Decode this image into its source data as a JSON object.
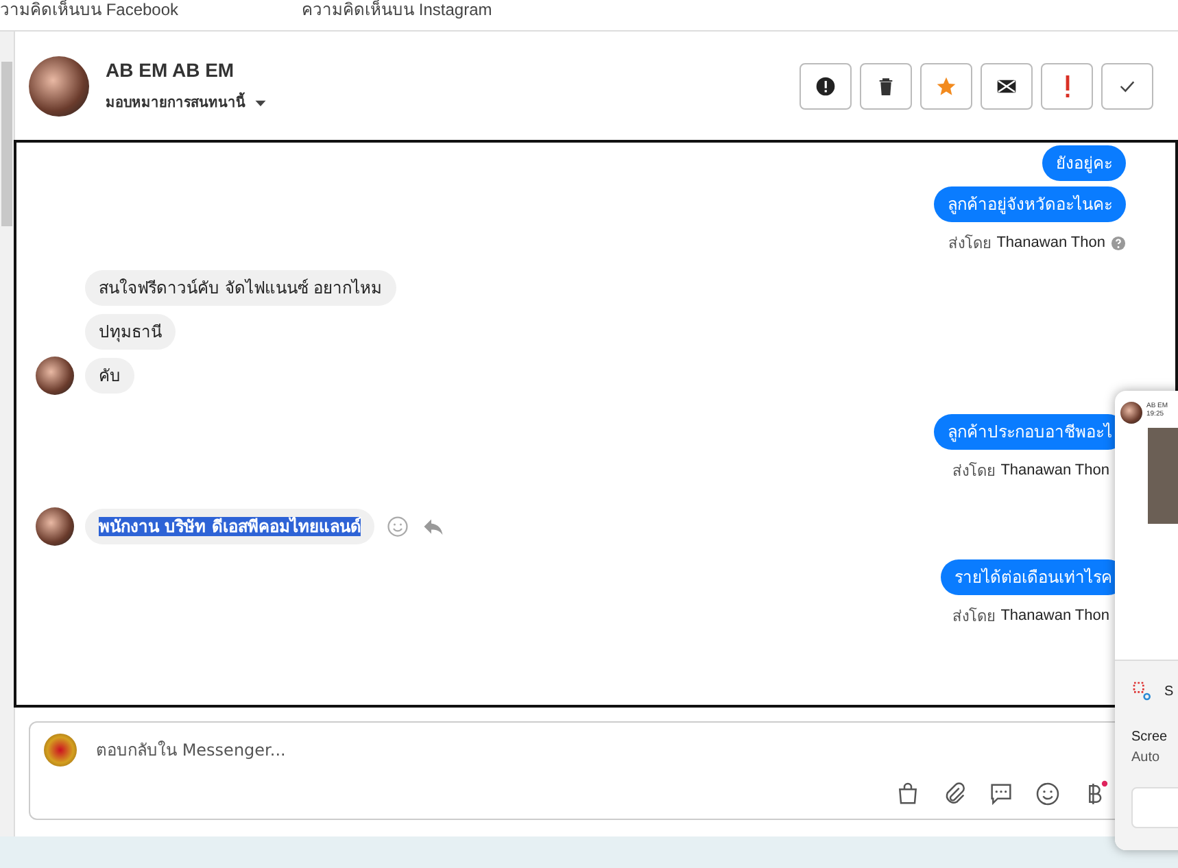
{
  "top_tabs": [
    {
      "label": "วามคิดเห็นบน Facebook"
    },
    {
      "label": "ความคิดเห็นบน Instagram"
    }
  ],
  "conversation": {
    "name": "AB EM AB EM",
    "assign_label": "มอบหมายการสนทนานี้"
  },
  "actions": [
    {
      "kind": "alert"
    },
    {
      "kind": "trash"
    },
    {
      "kind": "star"
    },
    {
      "kind": "mail"
    },
    {
      "kind": "important"
    },
    {
      "kind": "check"
    }
  ],
  "messages": [
    {
      "kind": "sent",
      "bubbles": [
        {
          "text": "ยังอยู่คะ",
          "highlighted": false
        },
        {
          "text": "ลูกค้าอยู่จังหวัดอะไนคะ",
          "highlighted": false
        }
      ],
      "sent_by": "ส่งโดย",
      "agent": "Thanawan Thon",
      "help": true
    },
    {
      "kind": "received",
      "bubbles": [
        {
          "text": "สนใจฟรีดาวน์คับ จัดไฟแนนซ์ อยากไหม",
          "highlighted": false
        },
        {
          "text": "ปทุมธานี",
          "highlighted": false
        },
        {
          "text": "คับ",
          "highlighted": false
        }
      ],
      "actions": false
    },
    {
      "kind": "sent",
      "bubbles": [
        {
          "text": "ลูกค้าประกอบอาชีพอะไ",
          "highlighted": false
        }
      ],
      "sent_by": "ส่งโดย",
      "agent": "Thanawan Thon",
      "help": false
    },
    {
      "kind": "received",
      "bubbles": [
        {
          "text": "พนักงาน บริษัท ดีเอสพีคอมไทยแลนด์",
          "highlighted": true
        }
      ],
      "actions": true
    },
    {
      "kind": "sent",
      "bubbles": [
        {
          "text": "รายได้ต่อเดือนเท่าไรค",
          "highlighted": false
        }
      ],
      "sent_by": "ส่งโดย",
      "agent": "Thanawan Thon",
      "help": false
    }
  ],
  "composer": {
    "placeholder": "ตอบกลับใน Messenger..."
  },
  "popup": {
    "preview_name": "AB EM",
    "preview_time": "19:25",
    "app_initial": "S",
    "title": "Scree",
    "subtitle": "Auto"
  }
}
